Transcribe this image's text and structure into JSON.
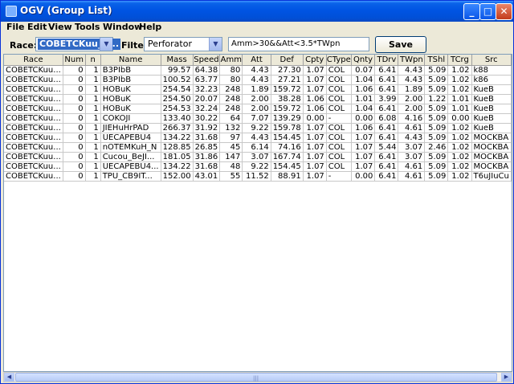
{
  "window": {
    "title": "OGV (Group List)",
    "minimize": "_",
    "maximize": "□",
    "close": "✕"
  },
  "menu": [
    "File",
    "Edit",
    "View",
    "Tools",
    "Window",
    "Help"
  ],
  "toolbar": {
    "race_label": "Race:",
    "race_value": "COBETCKuu_C...",
    "filter_label": "Filter:",
    "filter_value": "Perforator",
    "filter_expression": "Amm>30&&Att<3.5*TWpn",
    "save_label": "Save"
  },
  "table": {
    "columns": [
      "Race",
      "Num",
      "n",
      "Name",
      "Mass",
      "Speed",
      "Amm",
      "Att",
      "Def",
      "Cpty",
      "CType",
      "Qnty",
      "TDrv",
      "TWpn",
      "TShl",
      "TCrg",
      "Src"
    ],
    "rows": [
      [
        "COBETCKuu...",
        "0",
        "1",
        "B3PIbB",
        "99.57",
        "64.38",
        "80",
        "4.43",
        "27.30",
        "1.07",
        "COL",
        "0.07",
        "6.41",
        "4.43",
        "5.09",
        "1.02",
        "k88"
      ],
      [
        "COBETCKuu...",
        "0",
        "1",
        "B3PIbB",
        "100.52",
        "63.77",
        "80",
        "4.43",
        "27.21",
        "1.07",
        "COL",
        "1.04",
        "6.41",
        "4.43",
        "5.09",
        "1.02",
        "k86"
      ],
      [
        "COBETCKuu...",
        "0",
        "1",
        "HOBuK",
        "254.54",
        "32.23",
        "248",
        "1.89",
        "159.72",
        "1.07",
        "COL",
        "1.06",
        "6.41",
        "1.89",
        "5.09",
        "1.02",
        "KueB"
      ],
      [
        "COBETCKuu...",
        "0",
        "1",
        "HOBuK",
        "254.50",
        "20.07",
        "248",
        "2.00",
        "38.28",
        "1.06",
        "COL",
        "1.01",
        "3.99",
        "2.00",
        "1.22",
        "1.01",
        "KueB"
      ],
      [
        "COBETCKuu...",
        "0",
        "1",
        "HOBuK",
        "254.53",
        "32.24",
        "248",
        "2.00",
        "159.72",
        "1.06",
        "COL",
        "1.04",
        "6.41",
        "2.00",
        "5.09",
        "1.01",
        "KueB"
      ],
      [
        "COBETCKuu...",
        "0",
        "1",
        "COKOJI",
        "133.40",
        "30.22",
        "64",
        "7.07",
        "139.29",
        "0.00",
        "-",
        "0.00",
        "6.08",
        "4.16",
        "5.09",
        "0.00",
        "KueB"
      ],
      [
        "COBETCKuu...",
        "0",
        "1",
        "JIEHuHrPAD",
        "266.37",
        "31.92",
        "132",
        "9.22",
        "159.78",
        "1.07",
        "COL",
        "1.06",
        "6.41",
        "4.61",
        "5.09",
        "1.02",
        "KueB"
      ],
      [
        "COBETCKuu...",
        "0",
        "1",
        "UECAPEBU4",
        "134.22",
        "31.68",
        "97",
        "4.43",
        "154.45",
        "1.07",
        "COL",
        "1.07",
        "6.41",
        "4.43",
        "5.09",
        "1.02",
        "MOCKBA"
      ],
      [
        "COBETCKuu...",
        "0",
        "1",
        "nOTEMKuH_N",
        "128.85",
        "26.85",
        "45",
        "6.14",
        "74.16",
        "1.07",
        "COL",
        "1.07",
        "5.44",
        "3.07",
        "2.46",
        "1.02",
        "MOCKBA"
      ],
      [
        "COBETCKuu...",
        "0",
        "1",
        "Cucou_BeJI...",
        "181.05",
        "31.86",
        "147",
        "3.07",
        "167.74",
        "1.07",
        "COL",
        "1.07",
        "6.41",
        "3.07",
        "5.09",
        "1.02",
        "MOCKBA"
      ],
      [
        "COBETCKuu...",
        "0",
        "1",
        "UECAPEBU4...",
        "134.22",
        "31.68",
        "48",
        "9.22",
        "154.45",
        "1.07",
        "COL",
        "1.07",
        "6.41",
        "4.61",
        "5.09",
        "1.02",
        "MOCKBA"
      ],
      [
        "COBETCKuu...",
        "0",
        "1",
        "TPU_CB9IT...",
        "152.00",
        "43.01",
        "55",
        "11.52",
        "88.91",
        "1.07",
        "-",
        "0.00",
        "6.41",
        "4.61",
        "5.09",
        "1.02",
        "T6uJIuCu"
      ]
    ]
  },
  "scrollbar": {
    "left_arrow": "◀",
    "right_arrow": "▶",
    "grip": "|||"
  }
}
